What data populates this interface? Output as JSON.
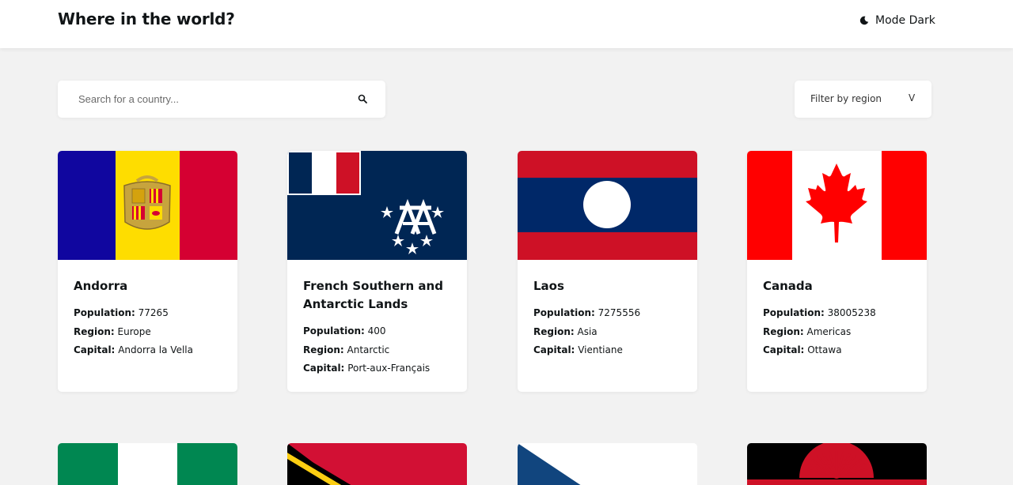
{
  "header": {
    "title": "Where in the world?",
    "mode_label": "Mode Dark",
    "mode_icon": "moon-icon"
  },
  "search": {
    "placeholder": "Search for a country...",
    "value": "",
    "icon": "search-icon"
  },
  "filter": {
    "label": "Filter by region",
    "chevron": "V"
  },
  "cards": [
    {
      "name": "Andorra",
      "population_label": "Population:",
      "population": "77265",
      "region_label": "Region:",
      "region": "Europe",
      "capital_label": "Capital:",
      "capital": "Andorra la Vella",
      "flag_icon": "andorra-flag-icon"
    },
    {
      "name": "French Southern and Antarctic Lands",
      "population_label": "Population:",
      "population": "400",
      "region_label": "Region:",
      "region": "Antarctic",
      "capital_label": "Capital:",
      "capital": "Port-aux-Français",
      "flag_icon": "french-southern-lands-flag-icon"
    },
    {
      "name": "Laos",
      "population_label": "Population:",
      "population": "7275556",
      "region_label": "Region:",
      "region": "Asia",
      "capital_label": "Capital:",
      "capital": "Vientiane",
      "flag_icon": "laos-flag-icon"
    },
    {
      "name": "Canada",
      "population_label": "Population:",
      "population": "38005238",
      "region_label": "Region:",
      "region": "Americas",
      "capital_label": "Capital:",
      "capital": "Ottawa",
      "flag_icon": "canada-flag-icon"
    }
  ],
  "partial_cards": [
    {
      "flag_icon": "nigeria-flag-icon"
    },
    {
      "flag_icon": "vanuatu-flag-icon"
    },
    {
      "flag_icon": "czechia-flag-icon"
    },
    {
      "flag_icon": "malawi-flag-icon"
    }
  ],
  "colors": {
    "background": "#f2f2f2",
    "surface": "#ffffff",
    "text": "#111517"
  }
}
